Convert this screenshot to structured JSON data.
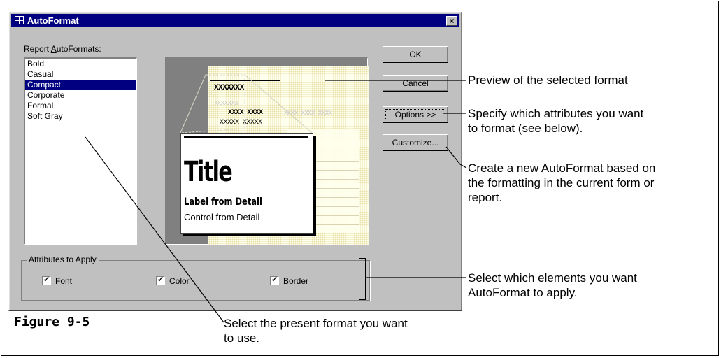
{
  "dialog": {
    "title": "AutoFormat",
    "close_glyph": "×",
    "formats_label": "Report AutoFormats:",
    "formats": [
      "Bold",
      "Casual",
      "Compact",
      "Corporate",
      "Formal",
      "Soft Gray"
    ],
    "selected_format": "Compact",
    "buttons": {
      "ok": "OK",
      "cancel": "Cancel",
      "options": "Options >>",
      "customize": "Customize..."
    },
    "attributes_label": "Attributes to Apply",
    "attributes": [
      {
        "label": "Font",
        "checked": true
      },
      {
        "label": "Color",
        "checked": true
      },
      {
        "label": "Border",
        "checked": true
      }
    ]
  },
  "preview": {
    "header_text": "XXXXXXX",
    "gray_text": "XXXXXXX",
    "row1": "XXXX XXXX",
    "row2": "XXXXX XXXXX",
    "gray_row": "XXXX XXXX XXXX",
    "callout_title": "Title",
    "callout_label": "Label from Detail",
    "callout_control": "Control from Detail"
  },
  "annotations": {
    "preview": "Preview of the selected format",
    "options": "Specify which attributes you want to format (see below).",
    "customize": "Create a new AutoFormat based on the formatting in the current form or report.",
    "attributes": "Select which elements you want AutoFormat to apply.",
    "list": "Select the present format you want to use.",
    "figure": "Figure 9-5"
  }
}
